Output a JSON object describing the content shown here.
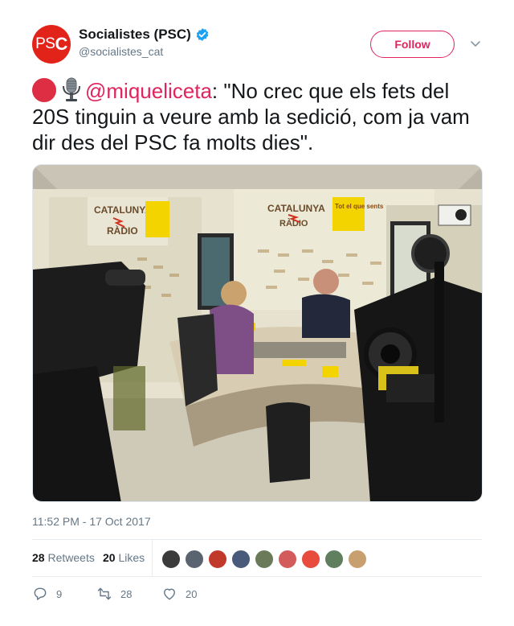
{
  "account": {
    "display_name": "Socialistes (PSC)",
    "handle": "@socialistes_cat",
    "avatar_text_ps": "PS",
    "avatar_text_c": "C",
    "verified": true,
    "brand_color": "#e2231a"
  },
  "follow_button": {
    "label": "Follow",
    "color": "#e0245e"
  },
  "tweet": {
    "emoji": [
      "red-circle-icon",
      "microphone-icon"
    ],
    "mention": "@miqueliceta",
    "text": ": \"No crec que els fets del 20S tinguin a veure amb la sedició, com ja vam dir des del PSC fa molts dies\".",
    "media": {
      "sign_main_line1": "CATALUNYA",
      "sign_main_line2": "RÀDIO",
      "sign_slogan": "Tot el que sents",
      "sign_left_line1": "CATALUNYA",
      "sign_left_line2": "RÀDIO"
    }
  },
  "timestamp": "11:52 PM - 17 Oct 2017",
  "stats": {
    "retweets_count": "28",
    "retweets_label": "Retweets",
    "likes_count": "20",
    "likes_label": "Likes",
    "liker_colors": [
      "#3b3b3b",
      "#5a6470",
      "#c0392b",
      "#4a5a7a",
      "#6b7b5a",
      "#d35b5b",
      "#e74c3c",
      "#5f7f5f",
      "#c8a070"
    ]
  },
  "actions": {
    "replies": "9",
    "retweets": "28",
    "likes": "20"
  },
  "colors": {
    "accent": "#e0245e",
    "muted": "#657786",
    "text": "#14171a"
  }
}
